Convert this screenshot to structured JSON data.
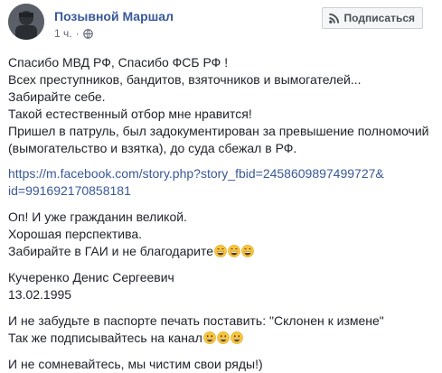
{
  "header": {
    "author_name": "Позывной Маршал",
    "timestamp": "1 ч.",
    "privacy_icon": "globe-icon",
    "subscribe_label": "Подписаться",
    "subscribe_icon": "rss-icon"
  },
  "post": {
    "lines_block1": [
      "Спасибо МВД РФ, Спасибо ФСБ РФ !",
      "Всех преступников, бандитов, взяточников и вымогателей...",
      "Забирайте себе.",
      "Такой естественный отбор мне нравится!",
      "Пришел в патруль, был задокументирован за превышение полномочий",
      "(вымогательство и взятка), до суда сбежал в РФ."
    ],
    "link_line1": "https://m.facebook.com/story.php?story_fbid=2458609897499727&",
    "link_line2": "id=991692170858181",
    "lines_block2": [
      "Оп! И уже гражданин великой.",
      "Хорошая перспектива.",
      "Забирайте в ГАИ и не благодарите"
    ],
    "name_line": "Кучеренко Денис Сергеевич",
    "date_line": "13.02.1995",
    "lines_block4": [
      "И не забудьте в паспорте печать поставить: \"Склонен к измене\"",
      "Так же подписывайтесь на канал"
    ],
    "final_line": "И не сомневайтесь, мы чистим свои ряды!)",
    "emoji_grin": "grinning-face-icon",
    "emoji_smile": "smiling-face-icon",
    "link_color": "#385898"
  }
}
